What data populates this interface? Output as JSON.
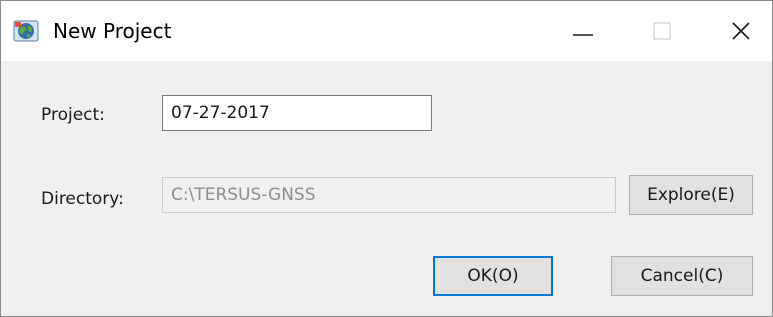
{
  "window": {
    "title": "New Project",
    "icon": "globe-app-icon",
    "controls": [
      "minimize-icon",
      "maximize-icon",
      "close-icon"
    ]
  },
  "form": {
    "project_label": "Project:",
    "project_value": "07-27-2017",
    "directory_label": "Directory:",
    "directory_value": "C:\\TERSUS-GNSS"
  },
  "buttons": {
    "explore": "Explore(E)",
    "ok": "OK(O)",
    "cancel": "Cancel(C)"
  },
  "colors": {
    "focus_border": "#0078d7",
    "dialog_background": "#f0f0f0",
    "titlebar_background": "#ffffff"
  }
}
